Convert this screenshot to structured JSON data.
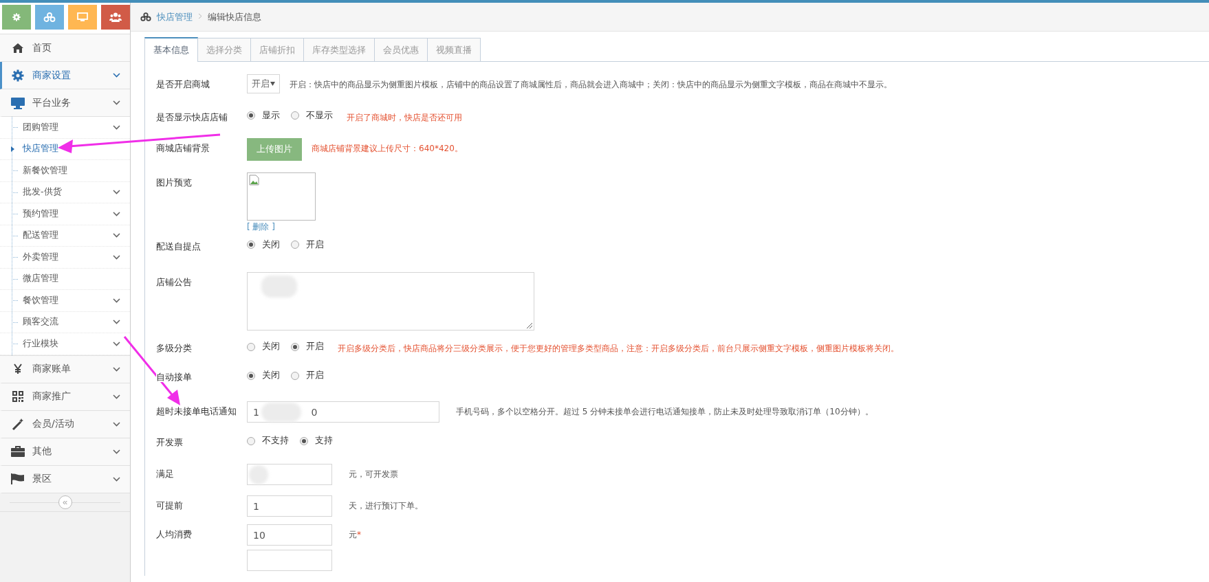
{
  "toolbar_buttons": [
    {
      "kind": "gear",
      "color": "#84b879"
    },
    {
      "kind": "cubes",
      "color": "#6fb3e0"
    },
    {
      "kind": "monitor",
      "color": "#ffb752"
    },
    {
      "kind": "users",
      "color": "#d15b47"
    }
  ],
  "sidebar": {
    "items": [
      {
        "label": "首页",
        "kind": "home",
        "has_submenu": false,
        "selected": false
      },
      {
        "label": "商家设置",
        "kind": "gear",
        "has_submenu": true,
        "selected": true
      },
      {
        "label": "平台业务",
        "kind": "monitor",
        "has_submenu": true,
        "selected": false,
        "children": [
          {
            "label": "团购管理",
            "has_submenu": true,
            "selected": false
          },
          {
            "label": "快店管理",
            "has_submenu": false,
            "selected": true
          },
          {
            "label": "新餐饮管理",
            "has_submenu": false,
            "selected": false
          },
          {
            "label": "批发-供货",
            "has_submenu": true,
            "selected": false
          },
          {
            "label": "预约管理",
            "has_submenu": true,
            "selected": false
          },
          {
            "label": "配送管理",
            "has_submenu": true,
            "selected": false
          },
          {
            "label": "外卖管理",
            "has_submenu": true,
            "selected": false
          },
          {
            "label": "微店管理",
            "has_submenu": false,
            "selected": false
          },
          {
            "label": "餐饮管理",
            "has_submenu": true,
            "selected": false
          },
          {
            "label": "顾客交流",
            "has_submenu": true,
            "selected": false
          },
          {
            "label": "行业模块",
            "has_submenu": true,
            "selected": false
          }
        ]
      },
      {
        "label": "商家账单",
        "kind": "yen",
        "has_submenu": true,
        "selected": false
      },
      {
        "label": "商家推广",
        "kind": "qrcode",
        "has_submenu": true,
        "selected": false
      },
      {
        "label": "会员/活动",
        "kind": "wand",
        "has_submenu": true,
        "selected": false
      },
      {
        "label": "其他",
        "kind": "briefcase",
        "has_submenu": true,
        "selected": false
      },
      {
        "label": "景区",
        "kind": "flag",
        "has_submenu": true,
        "selected": false
      }
    ],
    "collapse_button": "«"
  },
  "breadcrumb": [
    {
      "label": "快店管理",
      "kind": "link"
    },
    {
      "label": "编辑快店信息",
      "kind": "current"
    }
  ],
  "tabs": [
    {
      "label": "基本信息",
      "selected": true
    },
    {
      "label": "选择分类",
      "selected": false
    },
    {
      "label": "店铺折扣",
      "selected": false
    },
    {
      "label": "库存类型选择",
      "selected": false
    },
    {
      "label": "会员优惠",
      "selected": false
    },
    {
      "label": "视频直播",
      "selected": false
    }
  ],
  "form": {
    "rows": [
      {
        "kind": "select",
        "label": "是否开启商城",
        "value": "开启",
        "note": {
          "kind": "plain",
          "text": "开启：快店中的商品显示为侧重图片模板，店铺中的商品设置了商城属性后，商品就会进入商城中；关闭：快店中的商品显示为侧重文字模板，商品在商城中不显示。"
        }
      },
      {
        "kind": "radio",
        "label": "是否显示快店店铺",
        "options": [
          {
            "label": "显示",
            "selected": true
          },
          {
            "label": "不显示",
            "selected": false
          }
        ],
        "note": {
          "kind": "warning",
          "text": "开启了商城时，快店是否还可用"
        }
      },
      {
        "kind": "upload",
        "label": "商城店铺背景",
        "button": "上传图片",
        "note": {
          "kind": "warning",
          "text": "商城店铺背景建议上传尺寸：640*420。"
        }
      },
      {
        "kind": "preview",
        "label": "图片预览",
        "link": "[ 删除 ]"
      },
      {
        "kind": "radio",
        "label": "配送自提点",
        "options": [
          {
            "label": "关闭",
            "selected": true
          },
          {
            "label": "开启",
            "selected": false
          }
        ]
      },
      {
        "kind": "textarea",
        "label": "店铺公告",
        "redacted": true
      },
      {
        "kind": "radio",
        "label": "多级分类",
        "options": [
          {
            "label": "关闭",
            "selected": false
          },
          {
            "label": "开启",
            "selected": true
          }
        ],
        "note": {
          "kind": "warning",
          "text": "开启多级分类后，快店商品将分三级分类展示，便于您更好的管理多类型商品，注意：开启多级分类后，前台只展示侧重文字模板，侧重图片模板将关闭。"
        }
      },
      {
        "kind": "radio",
        "label": "自动接单",
        "options": [
          {
            "label": "关闭",
            "selected": true
          },
          {
            "label": "开启",
            "selected": false
          }
        ]
      },
      {
        "kind": "wide_input",
        "label": "超时未接单电话通知",
        "value": "1                 0",
        "redacted": true,
        "note": {
          "kind": "plain",
          "text": "手机号码，多个以空格分开。超过 5 分钟未接单会进行电话通知接单，防止未及时处理导致取消订单（10分钟）。"
        }
      },
      {
        "kind": "radio",
        "label": "开发票",
        "options": [
          {
            "label": "不支持",
            "selected": false
          },
          {
            "label": "支持",
            "selected": true
          }
        ]
      },
      {
        "kind": "input",
        "label": "满足",
        "redacted": true,
        "note": {
          "kind": "plain",
          "text": "元，可开发票"
        }
      },
      {
        "kind": "input",
        "label": "可提前",
        "value": "1",
        "note": {
          "kind": "plain",
          "text": "天，进行预订下单。"
        }
      },
      {
        "kind": "input",
        "label": "人均消费",
        "value": "10",
        "note": {
          "kind": "plain",
          "text": "元"
        },
        "required_mark": "*"
      },
      {
        "kind": "input"
      }
    ]
  }
}
